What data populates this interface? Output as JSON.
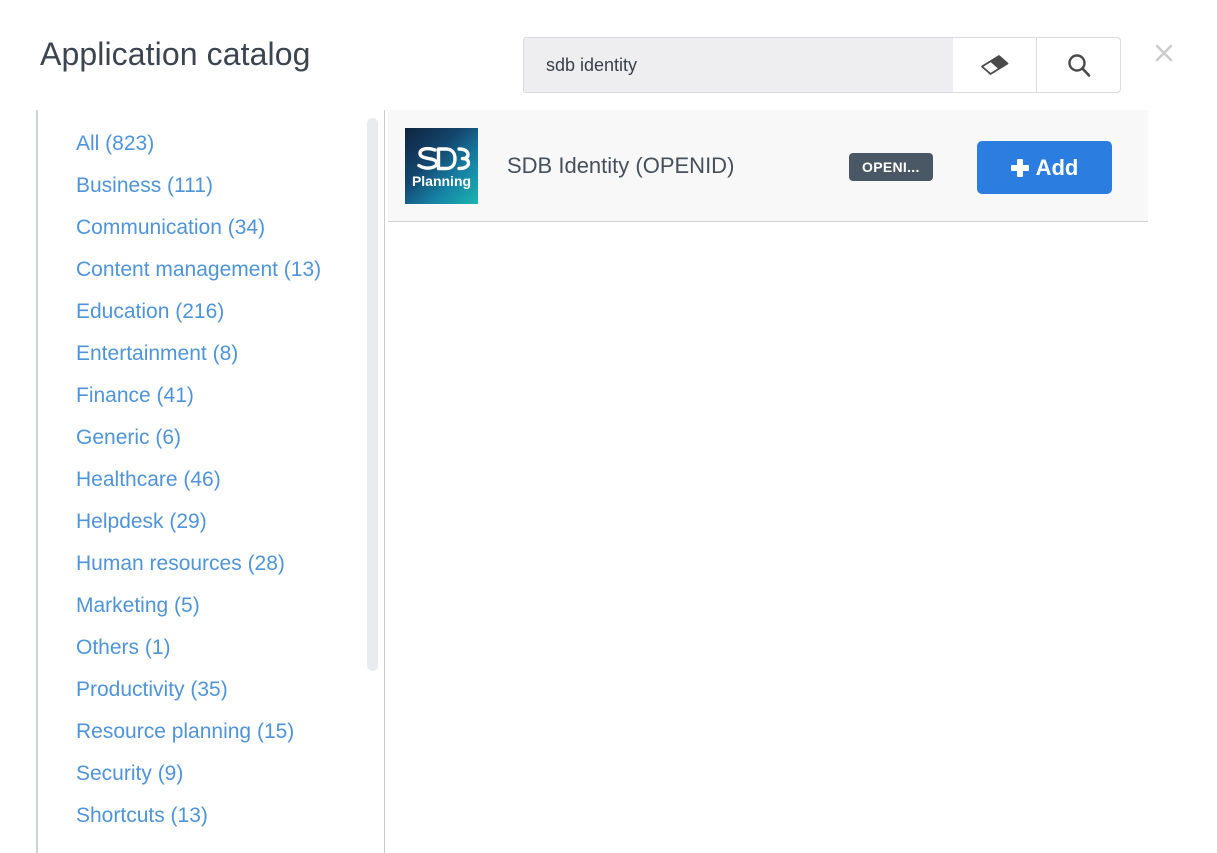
{
  "header": {
    "title": "Application catalog",
    "close_icon": "close-icon"
  },
  "search": {
    "value": "sdb identity",
    "placeholder": "",
    "clear_icon": "eraser-icon",
    "submit_icon": "search-icon"
  },
  "sidebar": {
    "categories": [
      {
        "label": "All (823)"
      },
      {
        "label": "Business (111)"
      },
      {
        "label": "Communication (34)"
      },
      {
        "label": "Content management (13)"
      },
      {
        "label": "Education (216)"
      },
      {
        "label": "Entertainment (8)"
      },
      {
        "label": "Finance (41)"
      },
      {
        "label": "Generic (6)"
      },
      {
        "label": "Healthcare (46)"
      },
      {
        "label": "Helpdesk (29)"
      },
      {
        "label": "Human resources (28)"
      },
      {
        "label": "Marketing (5)"
      },
      {
        "label": "Others (1)"
      },
      {
        "label": "Productivity (35)"
      },
      {
        "label": "Resource planning (15)"
      },
      {
        "label": "Security (9)"
      },
      {
        "label": "Shortcuts (13)"
      }
    ]
  },
  "results": [
    {
      "name": "SDB Identity (OPENID)",
      "badge": "OPENI...",
      "add_label": "Add",
      "logo": {
        "mark": "SDB",
        "subtitle": "Planning"
      }
    }
  ],
  "colors": {
    "link": "#4f94d9",
    "accent": "#2b7de0",
    "badge": "#4a5764",
    "title": "#3c4450",
    "search_bg": "#eeeef1"
  }
}
